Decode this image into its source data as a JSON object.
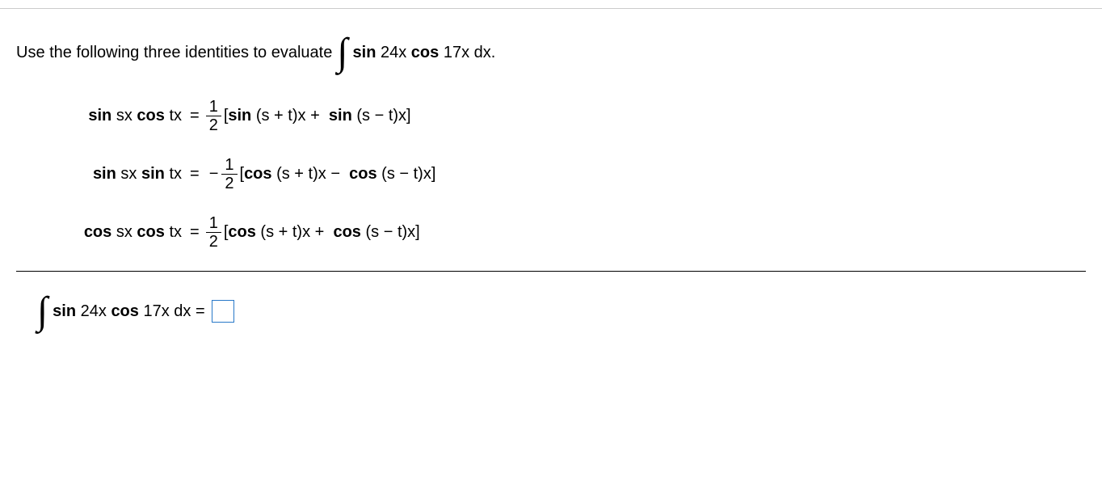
{
  "prompt": {
    "lead": "Use the following three identities to evaluate",
    "integrand_fn1": "sin",
    "integrand_arg1": "24x",
    "integrand_fn2": "cos",
    "integrand_arg2": "17x",
    "dx": "dx."
  },
  "frac": {
    "num": "1",
    "den": "2"
  },
  "identities": [
    {
      "lhs_fn1": "sin",
      "lhs_mid1": "sx",
      "lhs_fn2": "cos",
      "lhs_mid2": "tx",
      "neg": "",
      "term1_fn": "sin",
      "term1_arg": "(s + t)x",
      "op": "+",
      "term2_fn": "sin",
      "term2_arg": "(s − t)x"
    },
    {
      "lhs_fn1": "sin",
      "lhs_mid1": "sx",
      "lhs_fn2": "sin",
      "lhs_mid2": "tx",
      "neg": "−",
      "term1_fn": "cos",
      "term1_arg": "(s + t)x",
      "op": "−",
      "term2_fn": "cos",
      "term2_arg": "(s − t)x"
    },
    {
      "lhs_fn1": "cos",
      "lhs_mid1": "sx",
      "lhs_fn2": "cos",
      "lhs_mid2": "tx",
      "neg": "",
      "term1_fn": "cos",
      "term1_arg": "(s + t)x",
      "op": "+",
      "term2_fn": "cos",
      "term2_arg": "(s − t)x"
    }
  ],
  "answer": {
    "fn1": "sin",
    "arg1": "24x",
    "fn2": "cos",
    "arg2": "17x",
    "dx": "dx",
    "eq": "="
  }
}
